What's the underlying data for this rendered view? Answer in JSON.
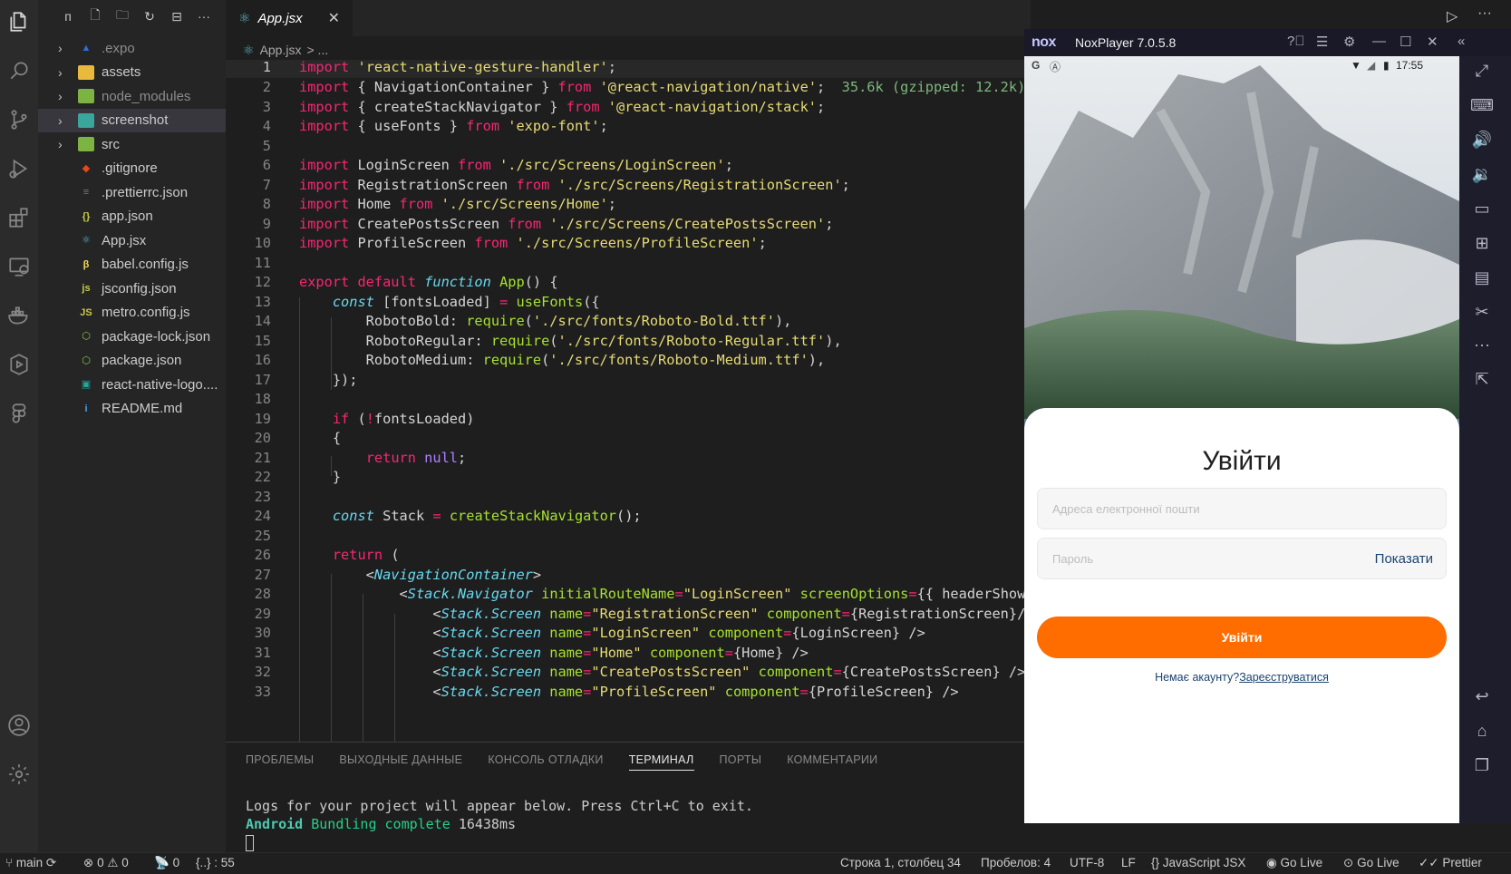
{
  "explorer": {
    "toolbar": [
      "п",
      "new-file",
      "new-folder",
      "refresh",
      "collapse",
      "more"
    ],
    "items": [
      {
        "chev": "›",
        "icon": "expo",
        "name": ".expo",
        "dim": true
      },
      {
        "chev": "›",
        "icon": "folder-yellow",
        "name": "assets"
      },
      {
        "chev": "›",
        "icon": "folder-green",
        "name": "node_modules",
        "dim": true
      },
      {
        "chev": "›",
        "icon": "folder-teal",
        "name": "screenshot",
        "selected": true
      },
      {
        "chev": "›",
        "icon": "folder-green",
        "name": "src"
      },
      {
        "icon": "git",
        "name": ".gitignore"
      },
      {
        "icon": "prettier",
        "name": ".prettierrc.json"
      },
      {
        "icon": "json",
        "name": "app.json"
      },
      {
        "icon": "react",
        "name": "App.jsx"
      },
      {
        "icon": "babel",
        "name": "babel.config.js"
      },
      {
        "icon": "jsconfig",
        "name": "jsconfig.json"
      },
      {
        "icon": "js",
        "name": "metro.config.js"
      },
      {
        "icon": "npm",
        "name": "package-lock.json"
      },
      {
        "icon": "npm",
        "name": "package.json"
      },
      {
        "icon": "image",
        "name": "react-native-logo...."
      },
      {
        "icon": "info",
        "name": "README.md"
      }
    ]
  },
  "editor": {
    "tab_name": "App.jsx",
    "breadcrumb_file": "App.jsx",
    "breadcrumb_sep": "> ...",
    "import_size": "35.6k (gzipped: 12.2k)"
  },
  "panel": {
    "tabs": [
      "ПРОБЛЕМЫ",
      "ВЫХОДНЫЕ ДАННЫЕ",
      "КОНСОЛЬ ОТЛАДКИ",
      "ТЕРМИНАЛ",
      "ПОРТЫ",
      "КОММЕНТАРИИ"
    ],
    "active_tab": "ТЕРМИНАЛ",
    "terminal_line1": "Logs for your project will appear below. Press Ctrl+C to exit.",
    "terminal_platform": "Android",
    "terminal_bundling": "Bundling complete",
    "terminal_time": "16438ms"
  },
  "status": {
    "branch": "main",
    "errors": "0",
    "warnings": "0",
    "ports": "0",
    "braces": "{..} : 55",
    "position": "Строка 1, столбец 34",
    "spaces": "Пробелов: 4",
    "encoding": "UTF-8",
    "eol": "LF",
    "language": "JavaScript JSX",
    "golive1": "Go Live",
    "golive2": "Go Live",
    "prettier": "Prettier"
  },
  "nox": {
    "logo": "nox",
    "title": "NoxPlayer 7.0.5.8",
    "time": "17:55",
    "login_title": "Увійти",
    "email_placeholder": "Адреса електронної пошти",
    "password_placeholder": "Пароль",
    "show_label": "Показати",
    "login_button": "Увійти",
    "no_account": "Немає акаунту?",
    "register_link": "Зареєструватися"
  },
  "colors": {
    "accent_orange": "#ff6c00",
    "link_blue": "#1b4371",
    "editor_bg": "#1e1e1e"
  }
}
